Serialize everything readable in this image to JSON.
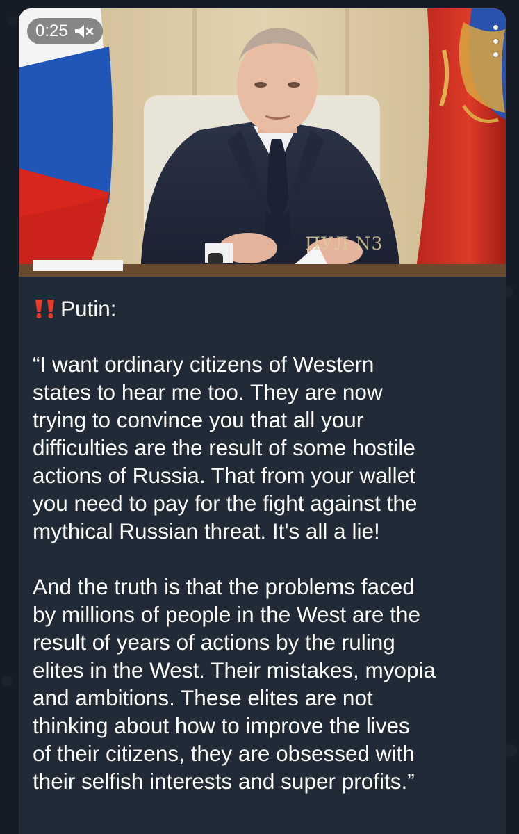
{
  "video": {
    "duration": "0:25",
    "mute_icon": "speaker-muted-icon",
    "menu_icon": "more-vertical-icon",
    "watermark": "ПУЛ N3"
  },
  "message": {
    "alert_icon": "double-exclamation-icon",
    "speaker": "Putin:",
    "lines": [
      "“I want ordinary citizens of Western",
      "states to hear me too. They are now",
      "trying to convince you that all your",
      "difficulties are the result of some hostile",
      "actions of Russia. That from your wallet",
      "you need to pay for the fight against the",
      "mythical Russian threat. It's all a lie!",
      "",
      "And the truth is that the problems faced",
      "by millions of people in the West are the",
      "result of years of actions by the ruling",
      "elites in the West. Their mistakes, myopia",
      "and ambitions. These elites are not",
      "thinking about how to improve the lives",
      "of their citizens, they are obsessed with",
      "their selfish interests and super profits.”"
    ]
  },
  "colors": {
    "background": "#151c25",
    "bubble": "#212b38",
    "text": "#ffffff",
    "alert": "#e8392b"
  }
}
